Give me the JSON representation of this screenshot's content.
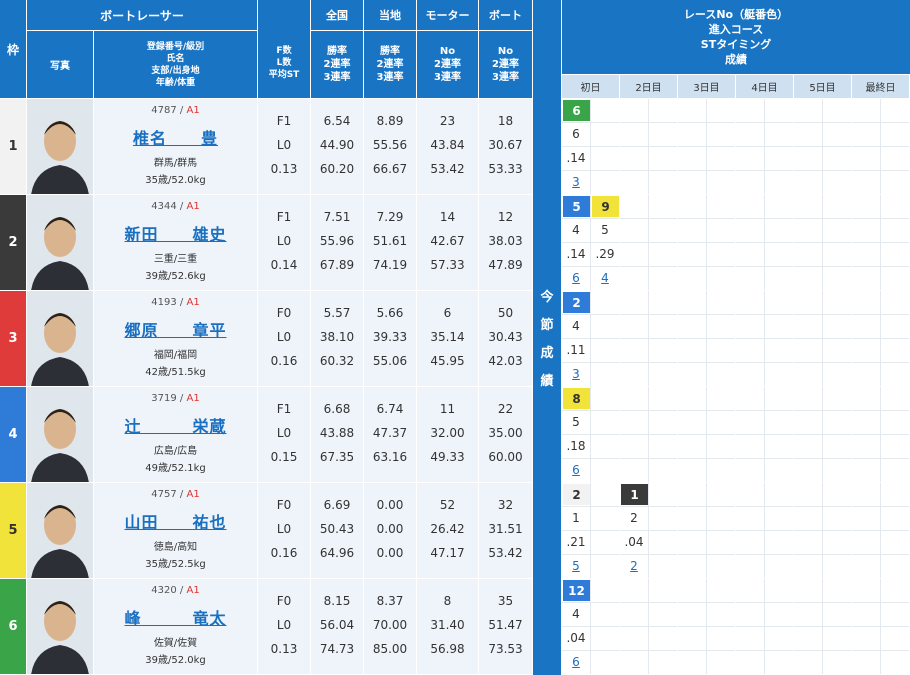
{
  "header": {
    "waku": "枠",
    "racer": "ボートレーサー",
    "photo": "写真",
    "info": [
      "登録番号/級別",
      "氏名",
      "支部/出身地",
      "年齢/体重"
    ],
    "fl": [
      "F数",
      "L数",
      "平均ST"
    ],
    "zenkoku": "全国",
    "touchi": "当地",
    "motor": "モーター",
    "boat": "ボート",
    "rates": [
      "勝率",
      "2連率",
      "3連率"
    ],
    "no_rates": [
      "No",
      "2連率",
      "3連率"
    ],
    "race_info": [
      "レースNo（艇番色）",
      "進入コース",
      "STタイミング",
      "成績"
    ],
    "days": [
      "初日",
      "2日目",
      "3日目",
      "4日目",
      "5日目",
      "最終日"
    ],
    "konsetsu": [
      "今",
      "節",
      "成",
      "績"
    ]
  },
  "racers": [
    {
      "waku": "1",
      "reg": "4787",
      "cls": "A1",
      "name": "椎名　　豊",
      "branch": "群馬/群馬",
      "age": "35歳/52.0kg",
      "f": "F1",
      "l": "L0",
      "st": "0.13",
      "zen": [
        "6.54",
        "44.90",
        "60.20"
      ],
      "toc": [
        "8.89",
        "55.56",
        "66.67"
      ],
      "motor": [
        "23",
        "43.84",
        "53.42"
      ],
      "boat": [
        "18",
        "30.67",
        "53.33"
      ],
      "waku_color": "#f2f2f2",
      "waku_text": "#333333"
    },
    {
      "waku": "2",
      "reg": "4344",
      "cls": "A1",
      "name": "新田　　雄史",
      "branch": "三重/三重",
      "age": "39歳/52.6kg",
      "f": "F1",
      "l": "L0",
      "st": "0.14",
      "zen": [
        "7.51",
        "55.96",
        "67.89"
      ],
      "toc": [
        "7.29",
        "51.61",
        "74.19"
      ],
      "motor": [
        "14",
        "42.67",
        "57.33"
      ],
      "boat": [
        "12",
        "38.03",
        "47.89"
      ],
      "waku_color": "#3a3a3a",
      "waku_text": "#ffffff"
    },
    {
      "waku": "3",
      "reg": "4193",
      "cls": "A1",
      "name": "郷原　　章平",
      "branch": "福岡/福岡",
      "age": "42歳/51.5kg",
      "f": "F0",
      "l": "L0",
      "st": "0.16",
      "zen": [
        "5.57",
        "38.10",
        "60.32"
      ],
      "toc": [
        "5.66",
        "39.33",
        "55.06"
      ],
      "motor": [
        "6",
        "35.14",
        "45.95"
      ],
      "boat": [
        "50",
        "30.43",
        "42.03"
      ],
      "waku_color": "#e03b3b",
      "waku_text": "#ffffff"
    },
    {
      "waku": "4",
      "reg": "3719",
      "cls": "A1",
      "name": "辻　　　栄蔵",
      "branch": "広島/広島",
      "age": "49歳/52.1kg",
      "f": "F1",
      "l": "L0",
      "st": "0.15",
      "zen": [
        "6.68",
        "43.88",
        "67.35"
      ],
      "toc": [
        "6.74",
        "47.37",
        "63.16"
      ],
      "motor": [
        "11",
        "32.00",
        "49.33"
      ],
      "boat": [
        "22",
        "35.00",
        "60.00"
      ],
      "waku_color": "#2f7bd8",
      "waku_text": "#ffffff"
    },
    {
      "waku": "5",
      "reg": "4757",
      "cls": "A1",
      "name": "山田　　祐也",
      "branch": "徳島/高知",
      "age": "35歳/52.5kg",
      "f": "F0",
      "l": "L0",
      "st": "0.16",
      "zen": [
        "6.69",
        "50.43",
        "64.96"
      ],
      "toc": [
        "0.00",
        "0.00",
        "0.00"
      ],
      "motor": [
        "52",
        "26.42",
        "47.17"
      ],
      "boat": [
        "32",
        "31.51",
        "53.42"
      ],
      "waku_color": "#f2e33a",
      "waku_text": "#333333"
    },
    {
      "waku": "6",
      "reg": "4320",
      "cls": "A1",
      "name": "峰　　　竜太",
      "branch": "佐賀/佐賀",
      "age": "39歳/52.0kg",
      "f": "F0",
      "l": "L0",
      "st": "0.13",
      "zen": [
        "8.15",
        "56.04",
        "74.73"
      ],
      "toc": [
        "8.37",
        "70.00",
        "85.00"
      ],
      "motor": [
        "8",
        "31.40",
        "56.98"
      ],
      "boat": [
        "35",
        "51.47",
        "73.53"
      ],
      "waku_color": "#3aa548",
      "waku_text": "#ffffff"
    }
  ],
  "results": [
    [
      {
        "race": "6",
        "color": "#3aa548",
        "tc": "#ffffff",
        "course": "6",
        "st": ".14",
        "rank": "3"
      }
    ],
    [
      {
        "race": "5",
        "color": "#2f7bd8",
        "tc": "#ffffff",
        "course": "4",
        "st": ".14",
        "rank": "6"
      },
      {
        "race": "9",
        "color": "#f2e33a",
        "tc": "#333333",
        "course": "5",
        "st": ".29",
        "rank": "4"
      }
    ],
    [
      {
        "race": "2",
        "color": "#2f7bd8",
        "tc": "#ffffff",
        "course": "4",
        "st": ".11",
        "rank": "3"
      }
    ],
    [
      {
        "race": "8",
        "color": "#f2e33a",
        "tc": "#333333",
        "course": "5",
        "st": ".18",
        "rank": "6"
      }
    ],
    [
      {
        "race": "2",
        "color": "#f2f2f2",
        "tc": "#333333",
        "course": "1",
        "st": ".21",
        "rank": "5"
      },
      null,
      {
        "race": "1",
        "color": "#3a3a3a",
        "tc": "#ffffff",
        "course": "2",
        "st": ".04",
        "rank": "2"
      }
    ],
    [
      {
        "race": "12",
        "color": "#2f7bd8",
        "tc": "#ffffff",
        "course": "4",
        "st": ".04",
        "rank": "6"
      }
    ]
  ]
}
